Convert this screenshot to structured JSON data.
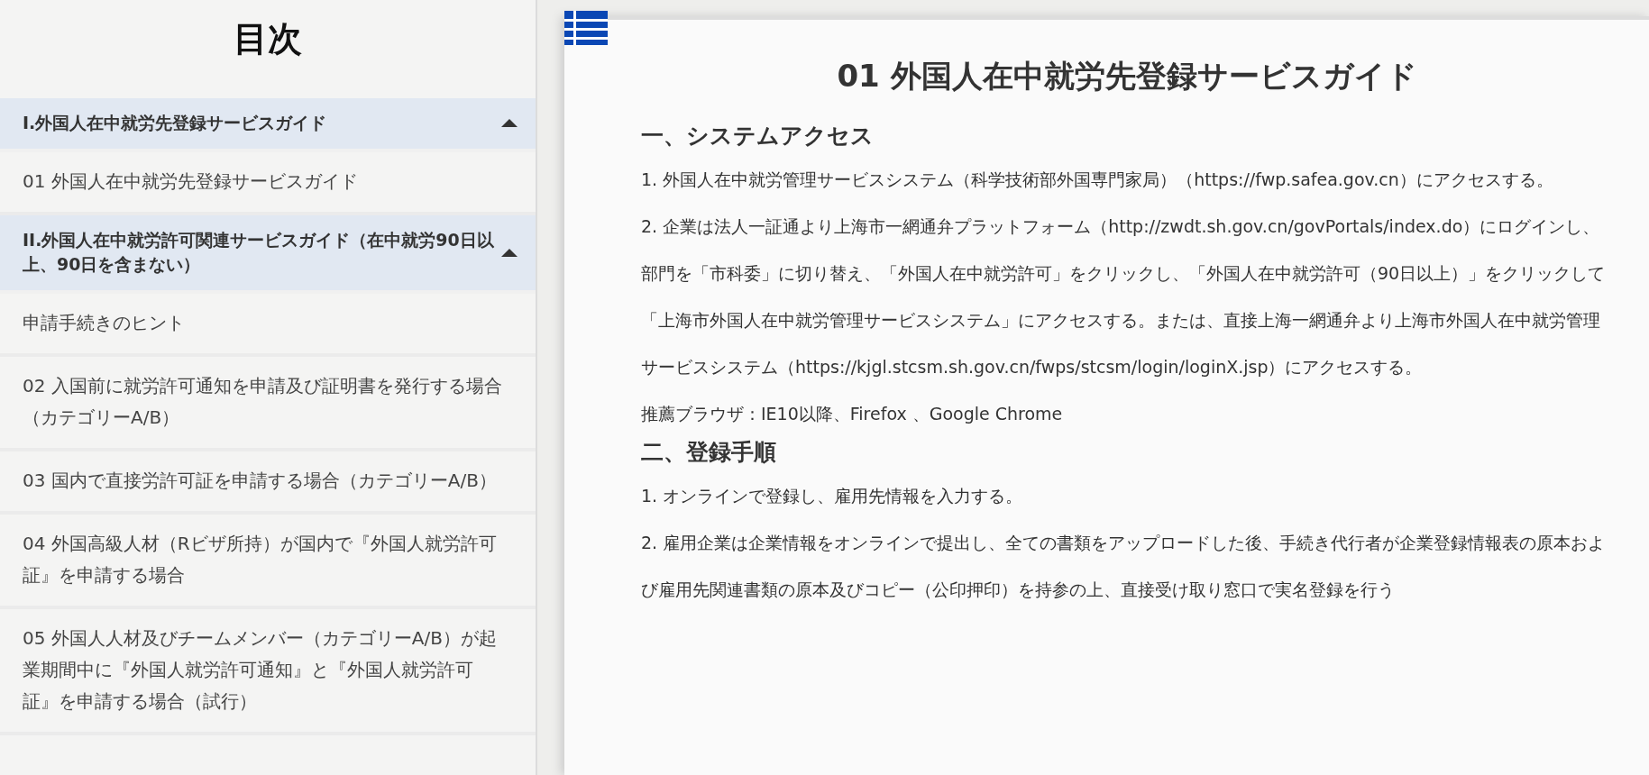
{
  "sidebar": {
    "title": "目次",
    "sections": [
      {
        "title": "I.外国人在中就労先登録サービスガイド",
        "expanded": true,
        "items": [
          "01 外国人在中就労先登録サービスガイド"
        ]
      },
      {
        "title": "II.外国人在中就労許可関連サービスガイド（在中就労90日以上、90日を含まない）",
        "expanded": true,
        "items": [
          "申請手続きのヒント",
          "02 入国前に就労許可通知を申請及び証明書を発行する場合（カテゴリーA/B）",
          "03 国内で直接労許可証を申請する場合（カテゴリーA/B）",
          "04 外国高級人材（Rビザ所持）が国内で『外国人就労許可証』を申請する場合",
          "05 外国人人材及びチームメンバー（カテゴリーA/B）が起業期間中に『外国人就労許可通知』と『外国人就労許可証』を申請する場合（試行）"
        ]
      }
    ]
  },
  "article": {
    "title": "01 外国人在中就労先登録サービスガイド",
    "blocks": [
      {
        "kind": "heading",
        "text": "一、システムアクセス"
      },
      {
        "kind": "paragraph",
        "text": "1. 外国人在中就労管理サービスシステム（科学技術部外国専門家局）（https://fwp.safea.gov.cn）にアクセスする。"
      },
      {
        "kind": "paragraph",
        "text": "2. 企業は法人一証通より上海市一網通弁プラットフォーム（http://zwdt.sh.gov.cn/govPortals/index.do）にログインし、部門を「市科委」に切り替え、「外国人在中就労許可」をクリックし、「外国人在中就労許可（90日以上）」をクリックして「上海市外国人在中就労管理サービスシステム」にアクセスする。または、直接上海一網通弁より上海市外国人在中就労管理サービスシステム（https://kjgl.stcsm.sh.gov.cn/fwps/stcsm/login/loginX.jsp）にアクセスする。"
      },
      {
        "kind": "paragraph",
        "text": "推薦ブラウザ：IE10以降、Firefox 、Google Chrome"
      },
      {
        "kind": "heading",
        "text": "二、登録手順"
      },
      {
        "kind": "paragraph",
        "text": "1. オンラインで登録し、雇用先情報を入力する。"
      },
      {
        "kind": "paragraph",
        "text": "2. 雇用企業は企業情報をオンラインで提出し、全ての書類をアップロードした後、手続き代行者が企業登録情報表の原本および雇用先関連書類の原本及びコピー（公印押印）を持参の上、直接受け取り窓口で実名登録を行う"
      }
    ]
  }
}
